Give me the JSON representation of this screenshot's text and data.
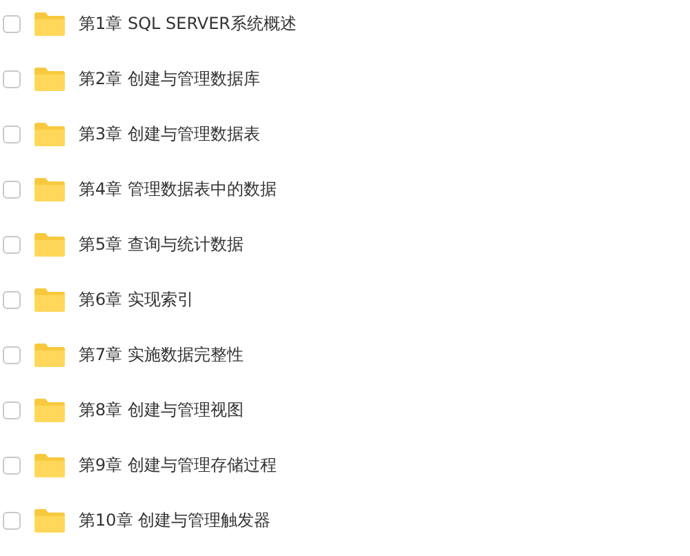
{
  "folders": [
    {
      "label": "第1章 SQL SERVER系统概述",
      "checked": false
    },
    {
      "label": "第2章 创建与管理数据库",
      "checked": false
    },
    {
      "label": "第3章 创建与管理数据表",
      "checked": false
    },
    {
      "label": "第4章 管理数据表中的数据",
      "checked": false
    },
    {
      "label": "第5章 查询与统计数据",
      "checked": false
    },
    {
      "label": "第6章 实现索引",
      "checked": false
    },
    {
      "label": "第7章 实施数据完整性",
      "checked": false
    },
    {
      "label": "第8章 创建与管理视图",
      "checked": false
    },
    {
      "label": "第9章 创建与管理存储过程",
      "checked": false
    },
    {
      "label": "第10章 创建与管理触发器",
      "checked": false
    }
  ]
}
